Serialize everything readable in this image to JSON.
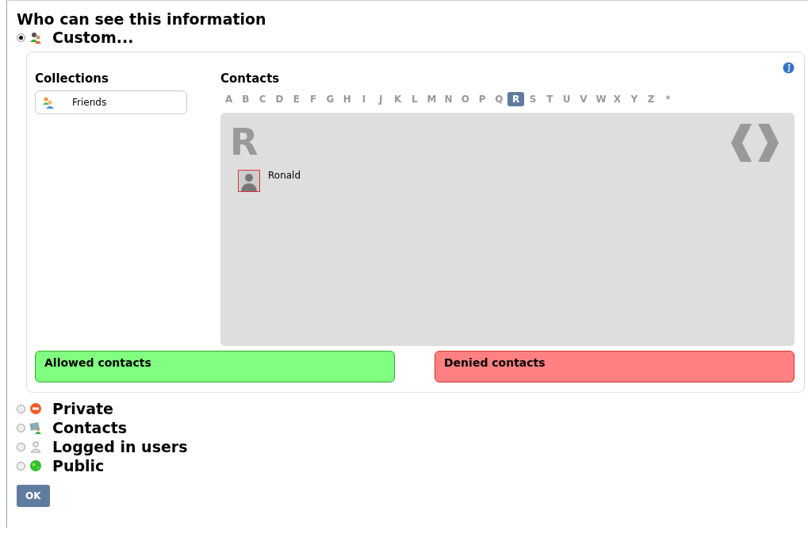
{
  "heading": "Who can see this information",
  "options": [
    {
      "kind": "custom",
      "label": "Custom...",
      "selected": true
    },
    {
      "kind": "private",
      "label": "Private",
      "selected": false
    },
    {
      "kind": "contacts",
      "label": "Contacts",
      "selected": false
    },
    {
      "kind": "users",
      "label": "Logged in users",
      "selected": false
    },
    {
      "kind": "public",
      "label": "Public",
      "selected": false
    }
  ],
  "custom_panel": {
    "collections_title": "Collections",
    "collections": [
      {
        "label": "Friends"
      }
    ],
    "contacts_title": "Contacts",
    "letters": [
      {
        "label": "A",
        "selected": false
      },
      {
        "label": "B",
        "selected": false
      },
      {
        "label": "C",
        "selected": false
      },
      {
        "label": "D",
        "selected": false
      },
      {
        "label": "E",
        "selected": false
      },
      {
        "label": "F",
        "selected": false
      },
      {
        "label": "G",
        "selected": false
      },
      {
        "label": "H",
        "selected": false
      },
      {
        "label": "I",
        "selected": false
      },
      {
        "label": "J",
        "selected": false
      },
      {
        "label": "K",
        "selected": false
      },
      {
        "label": "L",
        "selected": false
      },
      {
        "label": "M",
        "selected": false
      },
      {
        "label": "N",
        "selected": false
      },
      {
        "label": "O",
        "selected": false
      },
      {
        "label": "P",
        "selected": false
      },
      {
        "label": "Q",
        "selected": false
      },
      {
        "label": "R",
        "selected": true
      },
      {
        "label": "S",
        "selected": false
      },
      {
        "label": "T",
        "selected": false
      },
      {
        "label": "U",
        "selected": false
      },
      {
        "label": "V",
        "selected": false
      },
      {
        "label": "W",
        "selected": false
      },
      {
        "label": "X",
        "selected": false
      },
      {
        "label": "Y",
        "selected": false
      },
      {
        "label": "Z",
        "selected": false
      },
      {
        "label": "*",
        "selected": false
      }
    ],
    "group_letter": "R",
    "contacts": [
      {
        "name": "Ronald"
      }
    ],
    "allowed_label": "Allowed contacts",
    "denied_label": "Denied contacts"
  },
  "ok_button": "OK"
}
